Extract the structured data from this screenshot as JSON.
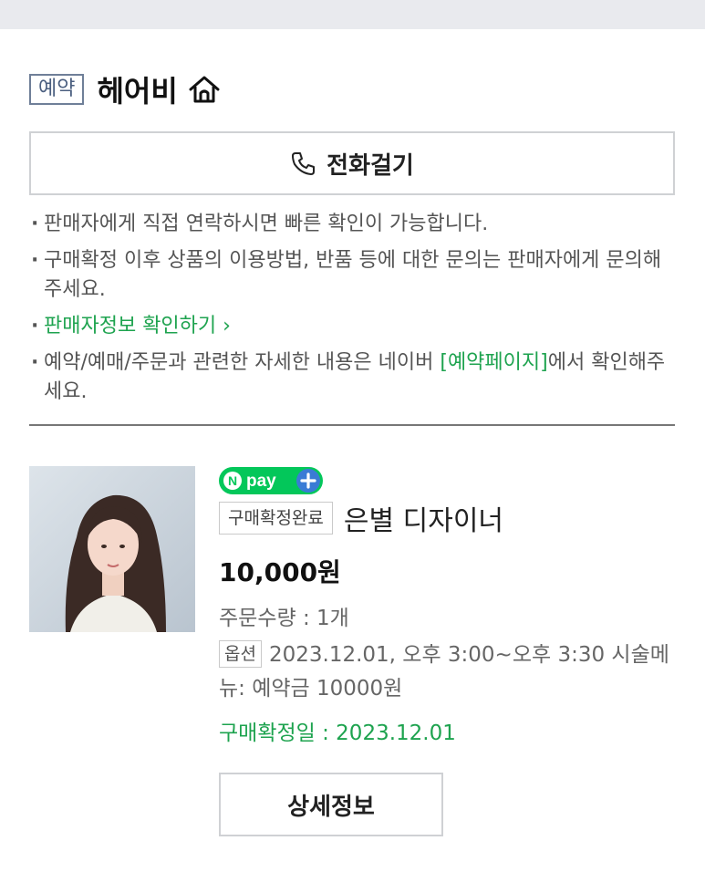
{
  "store": {
    "badge": "예약",
    "name": "헤어비",
    "home_icon": "home-icon"
  },
  "call_button": {
    "icon": "phone-icon",
    "label": "전화걸기"
  },
  "notice": {
    "line1": "판매자에게 직접 연락하시면 빠른 확인이 가능합니다.",
    "line2": "구매확정 이후 상품의 이용방법, 반품 등에 대한 문의는 판매자에게 문의해 주세요.",
    "seller_info_link": "판매자정보 확인하기",
    "line4_prefix": "예약/예매/주문과 관련한 자세한 내용은 네이버 ",
    "line4_link": "[예약페이지]",
    "line4_suffix": "에서 확인해주세요."
  },
  "order": {
    "npay_logo": "N pay +",
    "status": "구매확정완료",
    "product_name": "은별 디자이너",
    "price": "10,000원",
    "quantity": "주문수량 : 1개",
    "option_label": "옵션",
    "option_text": "2023.12.01, 오후 3:00~오후 3:30 시술메뉴: 예약금 10000원",
    "confirm_date": "구매확정일 : 2023.12.01",
    "detail_button": "상세정보"
  },
  "colors": {
    "accent_green": "#1ea34f",
    "badge_blue": "#4b5f80",
    "npay_green": "#03c75a",
    "npay_blue": "#3a7bd5"
  }
}
